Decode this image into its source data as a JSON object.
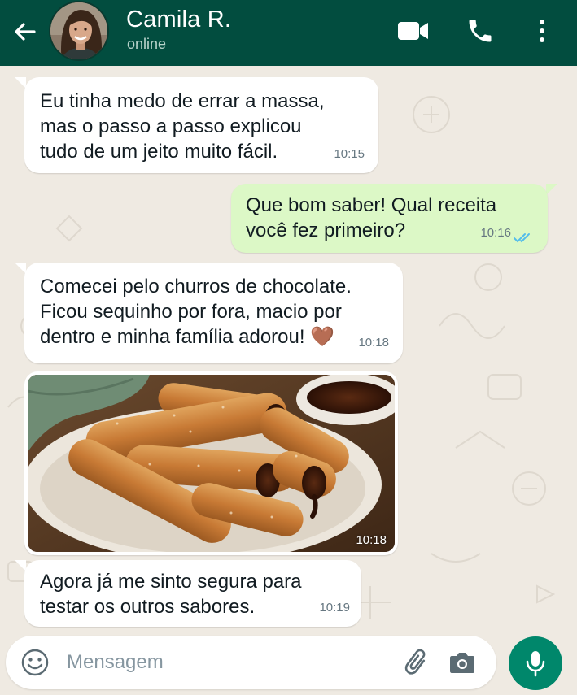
{
  "header": {
    "contact_name": "Camila R.",
    "status": "online"
  },
  "messages": [
    {
      "direction": "in",
      "text": "Eu tinha medo de errar a massa,\nmas o passo a passo explicou\ntudo de um jeito muito fácil.",
      "time": "10:15"
    },
    {
      "direction": "out",
      "text": "Que bom saber! Qual receita\nvocê fez primeiro?",
      "time": "10:16",
      "read": true
    },
    {
      "direction": "in",
      "text": "Comecei pelo churros de chocolate.\nFicou sequinho por fora, macio por\ndentro e minha família adorou! 🤎",
      "time": "10:18"
    },
    {
      "direction": "in",
      "type": "image",
      "image_subject": "churros-with-chocolate-filling",
      "time": "10:18"
    },
    {
      "direction": "in",
      "text": "Agora já me sinto segura para\ntestar os outros sabores.",
      "time": "10:19"
    }
  ],
  "input": {
    "placeholder": "Mensagem",
    "value": ""
  },
  "icons": {
    "back": "arrow-left-icon",
    "video": "video-camera-icon",
    "call": "phone-icon",
    "menu": "more-vertical-icon",
    "emoji": "smiley-icon",
    "attach": "paperclip-icon",
    "camera": "camera-icon",
    "mic": "microphone-icon"
  },
  "colors": {
    "header": "#024d3f",
    "incoming_bubble": "#ffffff",
    "outgoing_bubble": "#dcf8c6",
    "read_ticks": "#53bdeb",
    "mic_button": "#00876b",
    "chat_background": "#efeae2"
  }
}
